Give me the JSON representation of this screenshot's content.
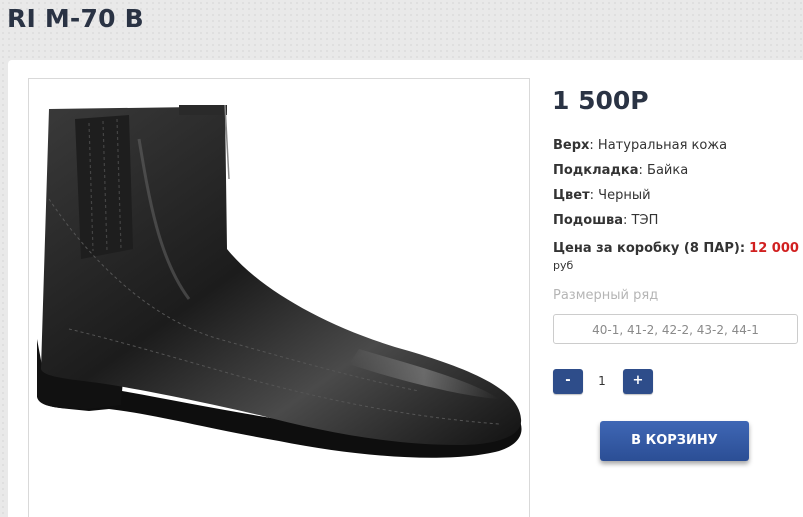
{
  "product": {
    "title": "RI M-70 B",
    "price": "1 500Р",
    "image_alt": "black leather ankle boot"
  },
  "specs": [
    {
      "label": "Верх",
      "value": ": Натуральная кожа"
    },
    {
      "label": "Подкладка",
      "value": ": Байка"
    },
    {
      "label": "Цвет",
      "value": ": Черный"
    },
    {
      "label": "Подошва",
      "value": ": ТЭП"
    }
  ],
  "box_price": {
    "label": "Цена за коробку (8 ПАР):",
    "value": "12 000",
    "currency": "руб"
  },
  "size": {
    "label": "Размерный ряд",
    "selected": "40-1, 41-2, 42-2, 43-2, 44-1"
  },
  "quantity": {
    "minus": "-",
    "value": "1",
    "plus": "+"
  },
  "cart": {
    "button_label": "В КОРЗИНУ"
  },
  "colors": {
    "accent": "#2e4d8a",
    "price_red": "#d12020",
    "title": "#2a3344"
  }
}
